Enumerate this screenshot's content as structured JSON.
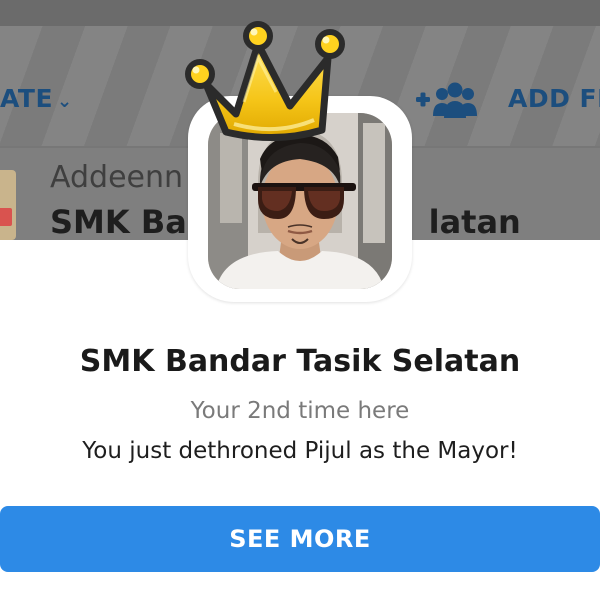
{
  "background": {
    "rate_label": "ATE",
    "add_friends_label": "ADD FR",
    "user_name": "Addeenn",
    "venue_name_left": "SMK Bar",
    "venue_name_right": "latan",
    "icons": [
      "chevron-down-icon",
      "add-friends-icon"
    ]
  },
  "modal": {
    "venue_name": "SMK Bandar Tasik Selatan",
    "visit_count": "Your 2nd time here",
    "message": "You just dethroned Pijul as the Mayor!",
    "button_label": "SEE MORE",
    "icons": [
      "crown-icon",
      "avatar"
    ]
  },
  "colors": {
    "accent": "#2d8ae6",
    "overlay_link": "#1c4e7e",
    "crown": "#f5c518"
  }
}
